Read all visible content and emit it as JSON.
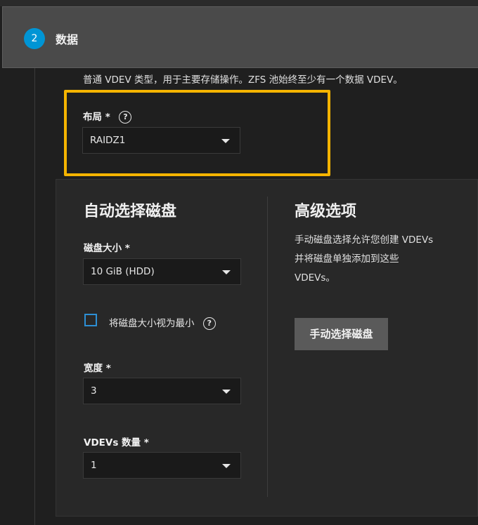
{
  "step": {
    "number": "2",
    "title": "数据"
  },
  "description": "普通 VDEV 类型，用于主要存储操作。ZFS 池始终至少有一个数据 VDEV。",
  "layout_field": {
    "label": "布局 *",
    "value": "RAIDZ1"
  },
  "auto_select": {
    "title": "自动选择磁盘",
    "disk_size": {
      "label": "磁盘大小 *",
      "value": "10 GiB (HDD)"
    },
    "treat_min": {
      "label": "将磁盘大小视为最小",
      "checked": false
    },
    "width": {
      "label": "宽度 *",
      "value": "3"
    },
    "vdev_count": {
      "label": "VDEVs 数量 *",
      "value": "1"
    }
  },
  "advanced": {
    "title": "高级选项",
    "text_line1": "手动磁盘选择允许您创建 VDEVs",
    "text_line2": "并将磁盘单独添加到这些",
    "text_line3": "VDEVs。",
    "button_label": "手动选择磁盘"
  },
  "help_glyph": "?",
  "colors": {
    "accent": "#0095d5",
    "highlight": "#f5b400",
    "checkbox": "#2d8fd4"
  }
}
